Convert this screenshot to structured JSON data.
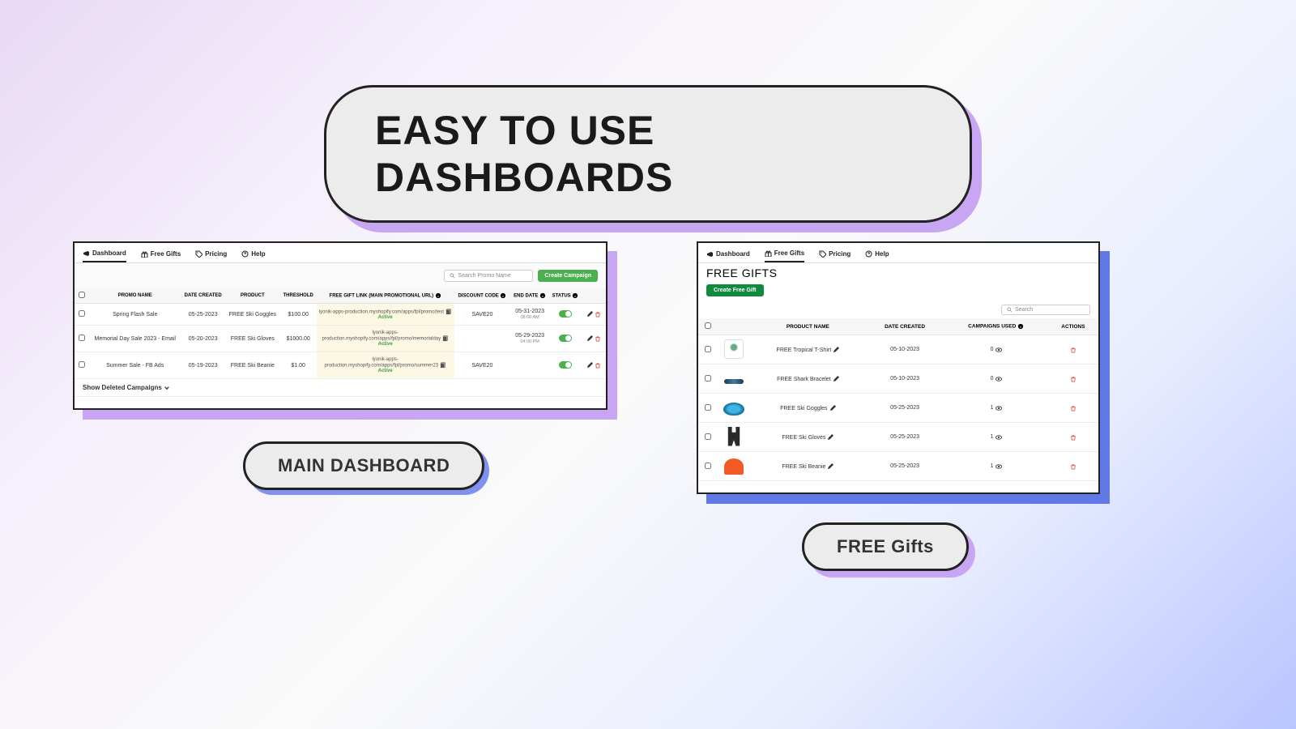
{
  "hero": "EASY TO USE DASHBOARDS",
  "labels": {
    "left": "MAIN DASHBOARD",
    "right": "FREE Gifts"
  },
  "nav": {
    "dashboard": "Dashboard",
    "freeGifts": "Free Gifts",
    "pricing": "Pricing",
    "help": "Help"
  },
  "left": {
    "searchPlaceholder": "Search Promo Name",
    "createBtn": "Create Campaign",
    "headers": {
      "promoName": "PROMO NAME",
      "dateCreated": "DATE CREATED",
      "product": "PRODUCT",
      "threshold": "THRESHOLD",
      "link": "FREE GIFT LINK (MAIN PROMOTIONAL URL)",
      "discount": "DISCOUNT CODE",
      "endDate": "END DATE",
      "status": "STATUS"
    },
    "rows": [
      {
        "name": "Spring Flash Sale",
        "date": "05-25-2023",
        "product": "FREE Ski Goggles",
        "threshold": "$100.00",
        "url": "lyonik-apps-production.myshopify.com/apps/fpl/promo/test",
        "active": "Active",
        "code": "SAVE20",
        "endDate": "05-31-2023",
        "endTime": "08:00 AM"
      },
      {
        "name": "Memorial Day Sale 2023 - Email",
        "date": "05-20-2023",
        "product": "FREE Ski Gloves",
        "threshold": "$1000.00",
        "url": "lyonik-apps-production.myshopify.com/apps/fpl/promo/memorialday",
        "active": "Active",
        "code": "",
        "endDate": "05-29-2023",
        "endTime": "04:00 PM"
      },
      {
        "name": "Summer Sale - FB Ads",
        "date": "05-19-2023",
        "product": "FREE Ski Beanie",
        "threshold": "$1.00",
        "url": "lyonik-apps-production.myshopify.com/apps/fpl/promo/summer23",
        "active": "Active",
        "code": "SAVE20",
        "endDate": "",
        "endTime": ""
      }
    ],
    "footer": "Show Deleted Campaigns"
  },
  "right": {
    "title": "FREE GIFTS",
    "createBtn": "Create Free Gift",
    "searchPlaceholder": "Search",
    "headers": {
      "productName": "PRODUCT NAME",
      "dateCreated": "DATE CREATED",
      "campaignsUsed": "CAMPAIGNS USED",
      "actions": "ACTIONS"
    },
    "rows": [
      {
        "name": "FREE Tropical T-Shirt",
        "date": "05-10-2023",
        "used": "0"
      },
      {
        "name": "FREE Shark Bracelet",
        "date": "05-10-2023",
        "used": "0"
      },
      {
        "name": "FREE Ski Goggles",
        "date": "05-25-2023",
        "used": "1"
      },
      {
        "name": "FREE Ski Gloves",
        "date": "05-25-2023",
        "used": "1"
      },
      {
        "name": "FREE Ski Beanie",
        "date": "05-25-2023",
        "used": "1"
      }
    ]
  }
}
